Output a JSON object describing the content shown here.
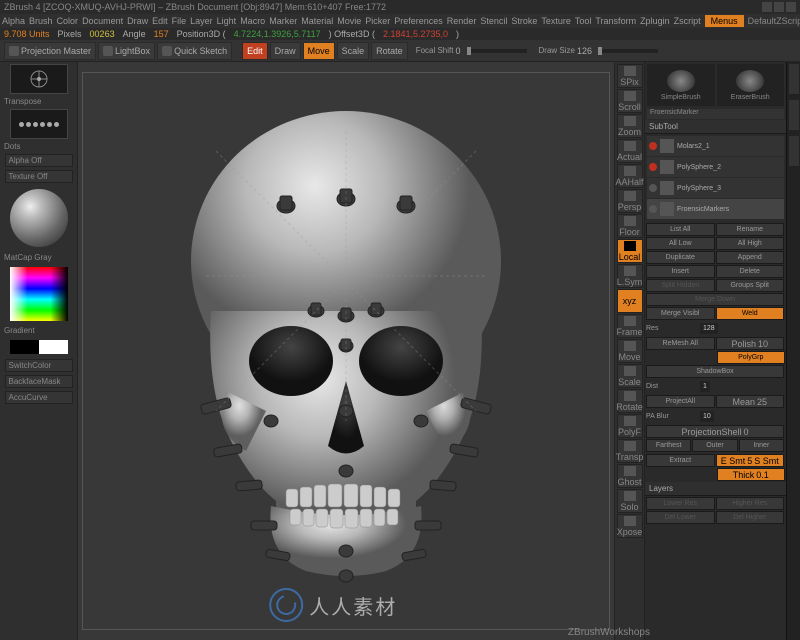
{
  "title": "ZBrush 4 [ZCOQ-XMUQ-AVHJ-PRWI] – ZBrush Document   [Obj:8947] Mem:610+407 Free:1772",
  "menubar": [
    "Alpha",
    "Brush",
    "Color",
    "Document",
    "Draw",
    "Edit",
    "File",
    "Layer",
    "Light",
    "Macro",
    "Marker",
    "Material",
    "Movie",
    "Picker",
    "Preferences",
    "Render",
    "Stencil",
    "Stroke",
    "Texture",
    "Tool",
    "Transform",
    "Zplugin",
    "Zscript"
  ],
  "menus_btn": "Menus",
  "script_label": "DefaultZScript",
  "info": {
    "units": "9.708 Units",
    "pixels_lbl": "Pixels",
    "pixels": "00263",
    "angle_lbl": "Angle",
    "angle": "157",
    "pos_lbl": "Position3D (",
    "pos": "4.7224,1.3926,5.7117",
    "offset_lbl": ") Offset3D (",
    "offset": "2.1841,5.2735,0",
    "close": ")"
  },
  "toolbar": {
    "projection_master": "Projection Master",
    "lightbox": "LightBox",
    "quick_sketch": "Quick Sketch",
    "edit": "Edit",
    "draw": "Draw",
    "move": "Move",
    "scale": "Scale",
    "rotate": "Rotate",
    "focal_shift_lbl": "Focal Shift",
    "focal_shift": "0",
    "draw_size_lbl": "Draw Size",
    "draw_size": "126"
  },
  "left": {
    "brush_mode": "Transpose",
    "stroke": "Dots",
    "alpha": "Alpha Off",
    "texture": "Texture Off",
    "matcap": "MatCap Gray",
    "gradient": "Gradient",
    "switch": "SwitchColor",
    "backface": "BackfaceMask",
    "accucurve": "AccuCurve"
  },
  "nav": [
    "SPix",
    "Scroll",
    "Zoom",
    "Actual",
    "AAHalf",
    "Persp",
    "Floor",
    "Local",
    "L.Sym",
    "xyz",
    "Frame",
    "Move",
    "Scale",
    "Rotate",
    "PolyF",
    "Transp",
    "Ghost",
    "Solo",
    "Xpose"
  ],
  "right": {
    "brush1": "SimpleBrush",
    "brush2": "EraserBrush",
    "tool_name": "FroensicMarker",
    "subtool_title": "SubTool",
    "subtools": [
      {
        "name": "Molars2_1"
      },
      {
        "name": "PolySphere_2"
      },
      {
        "name": "PolySphere_3"
      },
      {
        "name": "FroensicMarkers"
      }
    ],
    "btns": {
      "list_all": "List All",
      "rename": "Rename",
      "all_low": "All Low",
      "all_high": "All High",
      "duplicate": "Duplicate",
      "append": "Append",
      "insert": "Insert",
      "delete": "Delete",
      "split_hidden": "Split Hidden",
      "groups_split": "Groups Split",
      "merge_down": "Merge Down",
      "merge_visible": "Merge Visibl",
      "weld": "Weld",
      "remesh_all": "ReMesh All",
      "res_lbl": "Res",
      "res": "128",
      "polish_lbl": "Polish",
      "polish": "10",
      "polygrp": "PolyGrp",
      "shadowbox": "ShadowBox",
      "projectall": "ProjectAll",
      "dist_lbl": "Dist",
      "dist": "1",
      "mean_lbl": "Mean",
      "mean": "25",
      "pa_blur_lbl": "PA Blur",
      "pa_blur": "10",
      "projshell": "ProjectionShell",
      "projshell_v": "0",
      "farthest": "Farthest",
      "outer": "Outer",
      "inner": "Inner",
      "extract": "Extract",
      "esmt": "E Smt",
      "esmt_v": "5",
      "ssmt": "S Smt",
      "thick": "Thick",
      "thick_v": "0.1",
      "layers": "Layers",
      "lower_res": "Lower Res",
      "higher_res": "Higher Res",
      "del_lower": "Del Lower",
      "del_higher": "Del Higher"
    }
  },
  "footer": "ZBrushWorkshops",
  "watermark": "人人素材"
}
